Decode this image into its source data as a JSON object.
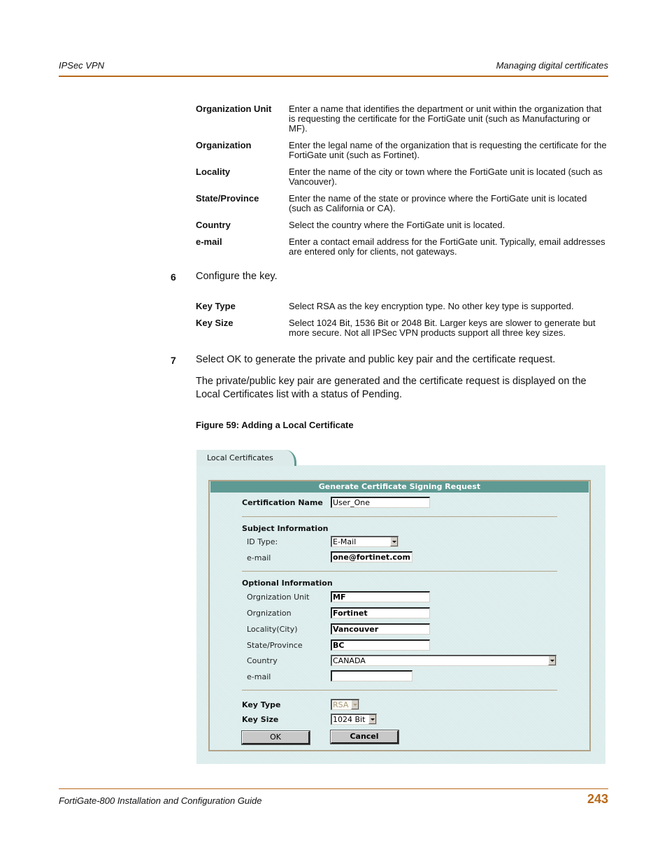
{
  "header": {
    "section": "IPSec VPN",
    "topic": "Managing digital certificates"
  },
  "subject_fields": [
    {
      "term": "Organization Unit",
      "desc": "Enter a name that identifies the department or unit within the organization that is requesting the certificate for the FortiGate unit (such as Manufacturing or MF)."
    },
    {
      "term": "Organization",
      "desc": "Enter the legal name of the organization that is requesting the certificate for the FortiGate unit (such as Fortinet)."
    },
    {
      "term": "Locality",
      "desc": "Enter the name of the city or town where the FortiGate unit is located (such as Vancouver)."
    },
    {
      "term": "State/Province",
      "desc": "Enter the name of the state or province where the FortiGate unit is located (such as California or CA)."
    },
    {
      "term": "Country",
      "desc": "Select the country where the FortiGate unit is located."
    },
    {
      "term": "e-mail",
      "desc": "Enter a contact email address for the FortiGate unit. Typically, email addresses are entered only for clients, not gateways."
    }
  ],
  "step6": {
    "number": "6",
    "text": "Configure the key."
  },
  "key_fields": [
    {
      "term": "Key Type",
      "desc": "Select RSA as the key encryption type. No other key type is supported."
    },
    {
      "term": "Key Size",
      "desc": "Select 1024 Bit, 1536 Bit or 2048 Bit. Larger keys are slower to generate but more secure. Not all IPSec VPN products support all three key sizes."
    }
  ],
  "step7": {
    "number": "7",
    "text": "Select OK to generate the private and public key pair and the certificate request.",
    "followup": "The private/public key pair are generated and the certificate request is displayed on the Local Certificates list with a status of Pending."
  },
  "figure": {
    "caption": "Figure 59: Adding a Local Certificate",
    "tab_label": "Local Certificates",
    "form_title": "Generate Certificate Signing Request",
    "cert_name": {
      "label": "Certification Name",
      "value": "User_One"
    },
    "subject_heading": "Subject Information",
    "id_type": {
      "label": "ID Type:",
      "value": "E-Mail"
    },
    "subject_email": {
      "label": "e-mail",
      "value": "one@fortinet.com"
    },
    "optional_heading": "Optional Information",
    "org_unit": {
      "label": "Orgnization Unit",
      "value": "MF"
    },
    "org": {
      "label": "Orgnization",
      "value": "Fortinet"
    },
    "locality": {
      "label": "Locality(City)",
      "value": "Vancouver"
    },
    "state": {
      "label": "State/Province",
      "value": "BC"
    },
    "country": {
      "label": "Country",
      "value": "CANADA"
    },
    "optional_email": {
      "label": "e-mail",
      "value": ""
    },
    "key_type": {
      "label": "Key Type",
      "value": "RSA"
    },
    "key_size": {
      "label": "Key Size",
      "value": "1024 Bit"
    },
    "ok_label": "OK",
    "cancel_label": "Cancel",
    "colors": {
      "titlebar": "#5e9a93",
      "panel": "#dcecec",
      "frame": "#b2a388"
    }
  },
  "footer": {
    "guide": "FortiGate-800 Installation and Configuration Guide",
    "page": "243"
  },
  "accent_color": "#b8691a"
}
